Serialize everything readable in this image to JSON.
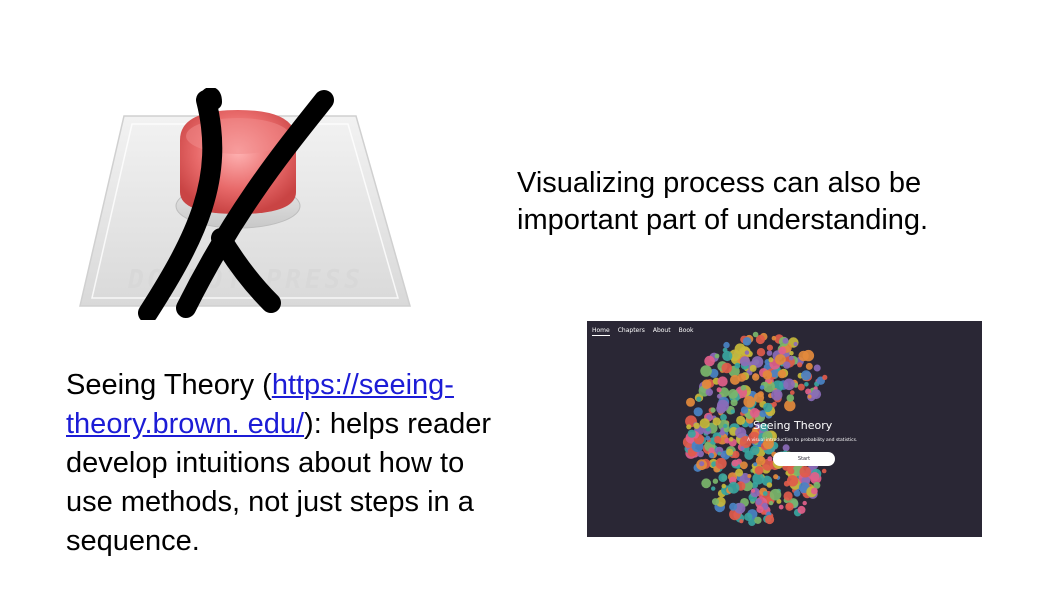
{
  "slide": {
    "statement_lines": [
      "Visualizing process can also be",
      "important part of understanding."
    ],
    "description": {
      "prefix": "Seeing Theory (",
      "link_line1": "https://seeing-",
      "link_line2": "theory.brown. edu/",
      "suffix_line2": "): helps reader",
      "lines_after": [
        "develop intuitions about how to",
        "use methods, not just steps in a",
        "sequence."
      ]
    },
    "illustration": {
      "stencil_text": "DO NOT PRESS",
      "icon": "crossed-out-red-button"
    }
  },
  "website": {
    "nav": [
      "Home",
      "Chapters",
      "About",
      "Book"
    ],
    "active_nav": "Home",
    "title": "Seeing Theory",
    "subtitle": "A visual introduction to probability and statistics.",
    "start_label": "Start",
    "background_color": "#2a2735",
    "dot_colors": [
      "#e05b4b",
      "#3aa5a0",
      "#c7b93b",
      "#e1608a",
      "#4a83c4",
      "#7bb66b",
      "#e38a3c",
      "#8b6bb8"
    ]
  }
}
